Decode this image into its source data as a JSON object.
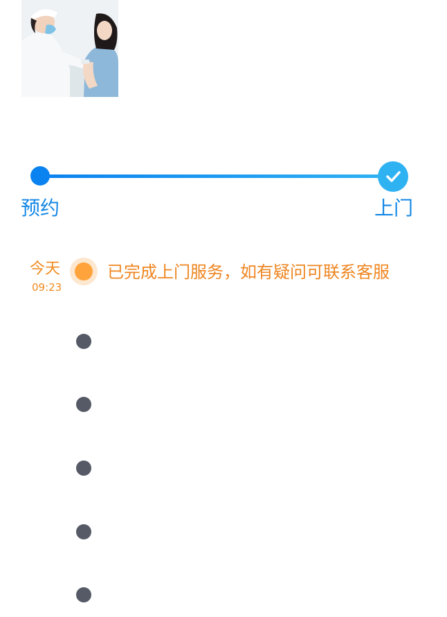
{
  "photo": {
    "description_icon": "vaccination-photo"
  },
  "progress": {
    "start_label": "预约",
    "end_label": "上门",
    "track_colors": [
      "#0a82f0",
      "#2fb2f2"
    ],
    "end_icon": "checkmark-icon",
    "completed": true
  },
  "timeline": {
    "current": {
      "day": "今天",
      "time": "09:23",
      "message": "已完成上门服务，如有疑问可联系客服",
      "accent": "#f08a1f"
    },
    "pending_count": 5,
    "pending_color": "#555a66"
  }
}
